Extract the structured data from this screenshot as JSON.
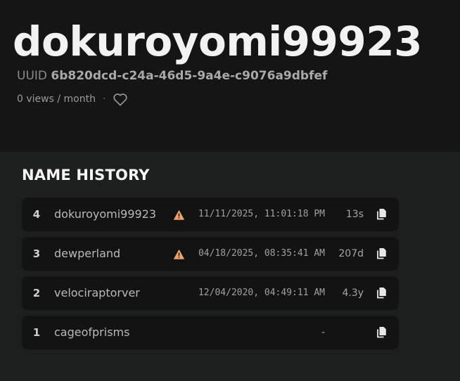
{
  "profile": {
    "username": "dokuroyomi99923",
    "uuid_label": "UUID",
    "uuid": "6b820dcd-c24a-46d5-9a4e-c9076a9dbfef",
    "views": "0 views / month",
    "separator": "·"
  },
  "name_history": {
    "title": "NAME HISTORY",
    "entries": [
      {
        "index": "4",
        "name": "dokuroyomi99923",
        "warning": true,
        "date": "11/11/2025, 11:01:18 PM",
        "age": "13s"
      },
      {
        "index": "3",
        "name": "dewperland",
        "warning": true,
        "date": "04/18/2025, 08:35:41 AM",
        "age": "207d"
      },
      {
        "index": "2",
        "name": "velociraptorver",
        "warning": false,
        "date": "12/04/2020, 04:49:11 AM",
        "age": "4.3y"
      },
      {
        "index": "1",
        "name": "cageofprisms",
        "warning": false,
        "date": "",
        "age": "-"
      }
    ]
  },
  "icons": {
    "heart": "heart-icon",
    "warning": "warning-icon",
    "copy": "copy-icon"
  },
  "colors": {
    "warning": "#f0a070",
    "background": "#1d1f1f",
    "hero_background": "#151516",
    "row_background": "#131314"
  }
}
